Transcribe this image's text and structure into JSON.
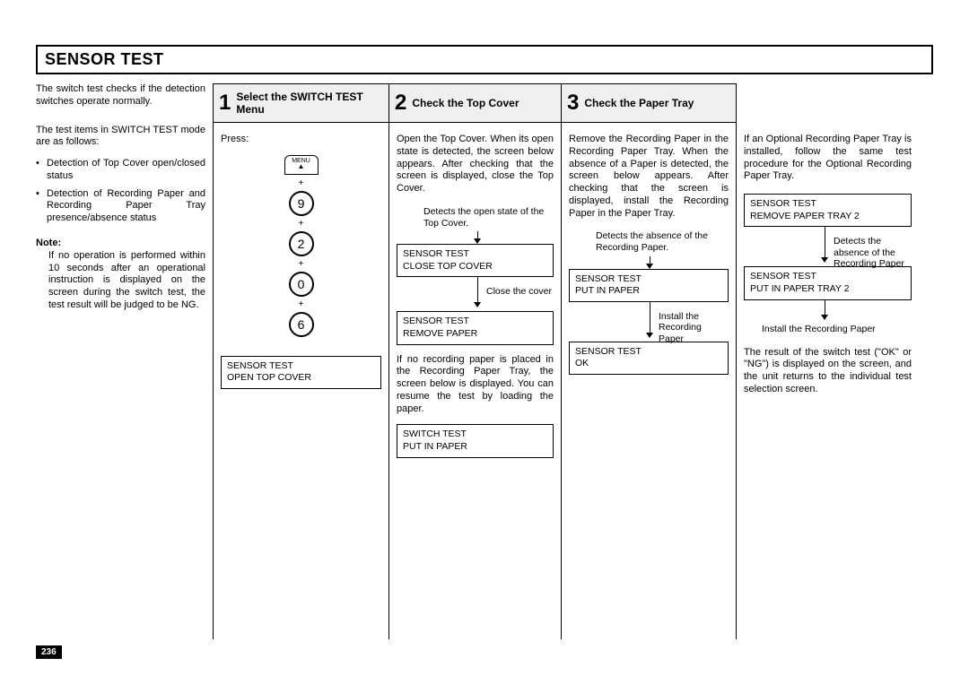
{
  "page_number": "236",
  "main_title": "SENSOR TEST",
  "intro": "The switch test checks if the detection switches operate normally.",
  "items_intro": "The test items in SWITCH TEST mode are as follows:",
  "bullets": [
    "Detection of Top Cover open/closed status",
    "Detection of Recording Paper and Recording Paper Tray presence/absence status"
  ],
  "note_label": "Note:",
  "note_body": "If no operation is performed within 10 seconds after an operational instruction is displayed on the screen during the switch test, the test result will be judged to be NG.",
  "step1": {
    "num": "1",
    "title": "Select the SWITCH TEST Menu",
    "press": "Press:",
    "menu": "MENU",
    "keys": [
      "9",
      "2",
      "0",
      "6"
    ],
    "screen": "SENSOR TEST\nOPEN TOP COVER"
  },
  "step2": {
    "num": "2",
    "title": "Check the Top Cover",
    "p1": "Open the Top Cover. When its open state is detected, the screen below appears. After checking that the screen is displayed, close the Top Cover.",
    "cap1": "Detects the open state of the Top Cover.",
    "screen1": "SENSOR TEST\nCLOSE TOP COVER",
    "cap2": "Close the cover",
    "screen2": "SENSOR TEST\nREMOVE PAPER",
    "p2": "If no recording paper is placed in the Recording Paper Tray, the screen below is displayed. You can resume the test by loading the paper.",
    "screen3": "SWITCH TEST\nPUT IN PAPER"
  },
  "step3": {
    "num": "3",
    "title": "Check the Paper Tray",
    "p1": "Remove the Recording Paper in the Recording Paper Tray. When the absence of a Paper is detected, the screen below appears. After checking that the screen is displayed, install the Recording Paper in the Paper Tray.",
    "cap1": "Detects the absence of the Recording Paper.",
    "screen1": "SENSOR TEST\nPUT IN PAPER",
    "cap2": "Install the Recording Paper",
    "screen2": "SENSOR TEST\nOK"
  },
  "col4": {
    "p1": "If an Optional Recording Paper Tray is installed, follow the same test procedure for the Optional Recording Paper Tray.",
    "screen1": "SENSOR TEST\nREMOVE PAPER TRAY 2",
    "cap1": "Detects the absence of the Recording Paper",
    "screen2": "SENSOR TEST\nPUT IN PAPER TRAY 2",
    "cap2": "Install the Recording Paper",
    "p2": "The result of the switch test (\"OK\" or \"NG\") is displayed on the screen, and the unit returns to the individual test selection screen."
  }
}
